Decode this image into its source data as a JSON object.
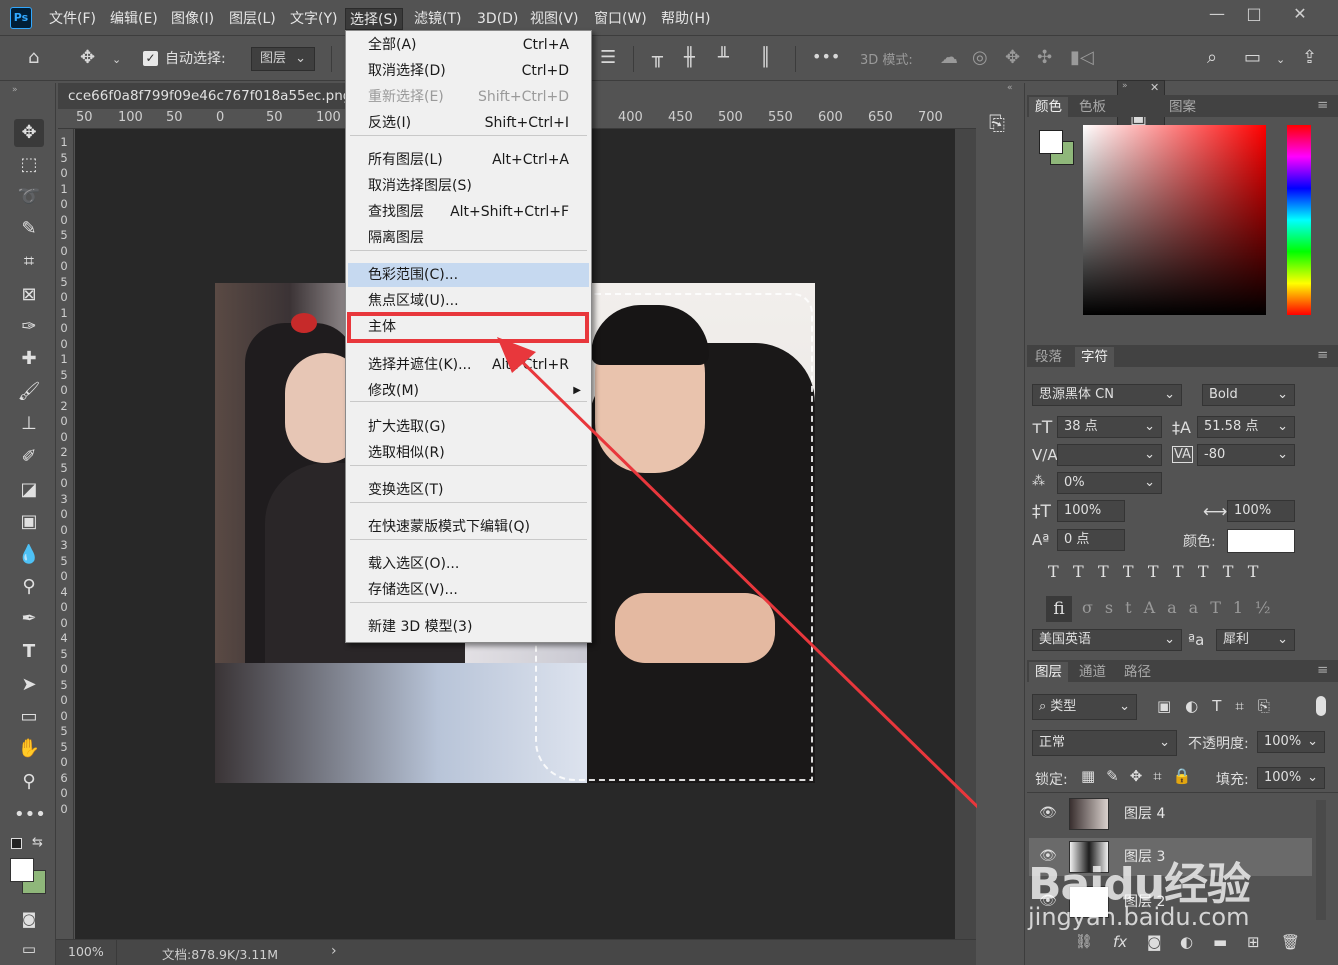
{
  "app": {
    "logo": "Ps"
  },
  "menubar": {
    "items": [
      "文件(F)",
      "编辑(E)",
      "图像(I)",
      "图层(L)",
      "文字(Y)",
      "选择(S)",
      "滤镜(T)",
      "3D(D)",
      "视图(V)",
      "窗口(W)",
      "帮助(H)"
    ],
    "window_buttons": [
      "—",
      "□",
      "✕"
    ]
  },
  "options": {
    "auto_select_label": "自动选择:",
    "auto_select_target": "图层",
    "mode_3d_label": "3D 模式:",
    "more": "•••"
  },
  "document": {
    "tab_title": "cce66f0a8f799f09e46c767f018a55ec.png ",
    "zoom": "100%",
    "doc_info": "文档:878.9K/3.11M",
    "ruler_h_labels": [
      "50",
      "100",
      "50",
      "0",
      "50",
      "100",
      "400",
      "450",
      "500",
      "550",
      "600",
      "650",
      "700"
    ],
    "ruler_v_labels": [
      "1",
      "5",
      "0",
      "1",
      "0",
      "0",
      "5",
      "0",
      "0",
      "5",
      "0",
      "1",
      "0",
      "0",
      "1",
      "5",
      "0",
      "2",
      "0",
      "0",
      "2",
      "5",
      "0",
      "3",
      "0",
      "0",
      "3",
      "5",
      "0",
      "4",
      "0",
      "0",
      "4",
      "5",
      "0",
      "5",
      "0",
      "0",
      "5",
      "5",
      "0",
      "6",
      "0",
      "0"
    ]
  },
  "select_menu": {
    "items": [
      {
        "label": "全部(A)",
        "shortcut": "Ctrl+A",
        "state": "normal"
      },
      {
        "label": "取消选择(D)",
        "shortcut": "Ctrl+D",
        "state": "normal"
      },
      {
        "label": "重新选择(E)",
        "shortcut": "Shift+Ctrl+D",
        "state": "disabled"
      },
      {
        "label": "反选(I)",
        "shortcut": "Shift+Ctrl+I",
        "state": "normal"
      },
      {
        "label": "所有图层(L)",
        "shortcut": "Alt+Ctrl+A",
        "state": "normal"
      },
      {
        "label": "取消选择图层(S)",
        "shortcut": "",
        "state": "normal"
      },
      {
        "label": "查找图层",
        "shortcut": "Alt+Shift+Ctrl+F",
        "state": "normal"
      },
      {
        "label": "隔离图层",
        "shortcut": "",
        "state": "normal"
      },
      {
        "label": "色彩范围(C)...",
        "shortcut": "",
        "state": "highlighted"
      },
      {
        "label": "焦点区域(U)...",
        "shortcut": "",
        "state": "normal"
      },
      {
        "label": "主体",
        "shortcut": "",
        "state": "normal"
      },
      {
        "label": "选择并遮住(K)...",
        "shortcut": "Alt+Ctrl+R",
        "state": "normal"
      },
      {
        "label": "修改(M)",
        "shortcut": "▶",
        "state": "normal"
      },
      {
        "label": "扩大选取(G)",
        "shortcut": "",
        "state": "normal"
      },
      {
        "label": "选取相似(R)",
        "shortcut": "",
        "state": "normal"
      },
      {
        "label": "变换选区(T)",
        "shortcut": "",
        "state": "normal"
      },
      {
        "label": "在快速蒙版模式下编辑(Q)",
        "shortcut": "",
        "state": "normal"
      },
      {
        "label": "载入选区(O)...",
        "shortcut": "",
        "state": "normal"
      },
      {
        "label": "存储选区(V)...",
        "shortcut": "",
        "state": "normal"
      },
      {
        "label": "新建 3D 模型(3)",
        "shortcut": "",
        "state": "normal"
      }
    ]
  },
  "color_panel": {
    "tabs": [
      "颜色",
      "色板",
      "图案"
    ],
    "fg_color": "#ffffff",
    "bg_color": "#8fb77a"
  },
  "char_panel": {
    "tabs": [
      "段落",
      "字符"
    ],
    "font_family": "思源黑体 CN",
    "font_style": "Bold",
    "size": "38 点",
    "leading": "51.58 点",
    "kerning": "",
    "tracking": "-80",
    "vscale_pct": "0%",
    "vert_scale": "100%",
    "horiz_scale": "100%",
    "baseline": "0 点",
    "color_label": "颜色:",
    "language": "美国英语",
    "aa_label": "ªa",
    "antialias": "犀利"
  },
  "layers_panel": {
    "tabs": [
      "图层",
      "通道",
      "路径"
    ],
    "filter_label": "类型",
    "blend_mode": "正常",
    "opacity_label": "不透明度:",
    "opacity": "100%",
    "lock_label": "锁定:",
    "fill_label": "填充:",
    "fill": "100%",
    "layers": [
      {
        "name": "图层 4",
        "visible": true,
        "selected": false
      },
      {
        "name": "图层 3",
        "visible": true,
        "selected": true
      },
      {
        "name": "图层 2",
        "visible": true,
        "selected": false
      }
    ],
    "footer_fx": "fx"
  },
  "watermark": {
    "brand": "Baidu经验",
    "url": "jingyan.baidu.com"
  }
}
